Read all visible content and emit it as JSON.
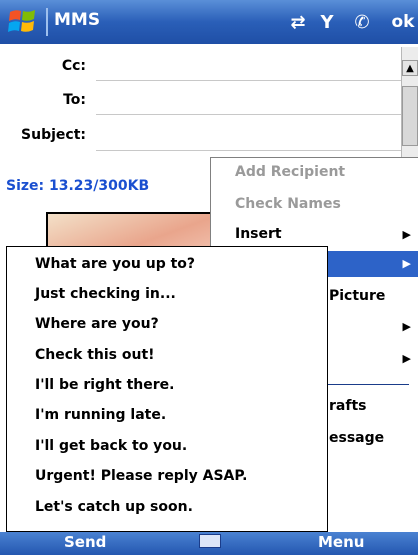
{
  "title_bar": {
    "app_title": "MMS",
    "ok_label": "ok",
    "status_icons": [
      "connectivity-icon",
      "signal-icon",
      "phone-icon"
    ]
  },
  "form": {
    "cc_label": "Cc:",
    "to_label": "To:",
    "subject_label": "Subject:",
    "size_text": "Size: 13.23/300KB"
  },
  "menu": {
    "items": [
      {
        "label": "Add Recipient",
        "enabled": false
      },
      {
        "label": "Check Names",
        "enabled": false
      },
      {
        "label": "Insert",
        "has_submenu": true
      },
      {
        "label": "",
        "has_submenu": true,
        "highlighted": true
      },
      {
        "label": "Picture"
      },
      {
        "label": "",
        "has_submenu": true
      },
      {
        "label": "",
        "has_submenu": true
      },
      {
        "label": "rafts"
      },
      {
        "label": "essage"
      }
    ]
  },
  "quick_text": {
    "items": [
      "What are you up to?",
      "Just checking in...",
      "Where are you?",
      "Check this out!",
      "I'll be right there.",
      "I'm running late.",
      "I'll get back to you.",
      "Urgent! Please reply ASAP.",
      "Let's catch up soon."
    ]
  },
  "softkeys": {
    "left": "Send",
    "right": "Menu"
  },
  "colors": {
    "title_bar": "#2a5fb8",
    "menu_highlight": "#2d63c8",
    "size_text": "#1a4fd0"
  }
}
